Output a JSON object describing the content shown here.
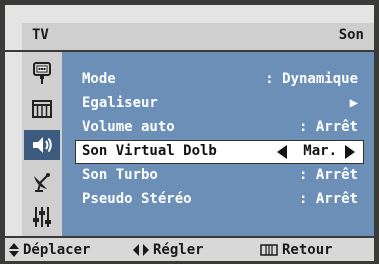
{
  "header": {
    "tv_label": "TV",
    "section_title": "Son"
  },
  "sidebar": {
    "items": [
      {
        "icon": "antenna-input-icon"
      },
      {
        "icon": "picture-grid-icon"
      },
      {
        "icon": "speaker-icon",
        "active": true
      },
      {
        "icon": "satellite-dish-icon"
      },
      {
        "icon": "settings-sliders-icon"
      }
    ]
  },
  "menu": {
    "items": [
      {
        "label": "Mode",
        "value": ": Dynamique"
      },
      {
        "label": "Egaliseur",
        "value": "▶"
      },
      {
        "label": "Volume auto",
        "value": ": Arrêt"
      },
      {
        "label": "Son Virtual Dolb",
        "value": "Mar.",
        "selected": true
      },
      {
        "label": "Son Turbo",
        "value": ": Arrêt"
      },
      {
        "label": "Pseudo Stéréo",
        "value": ": Arrêt"
      }
    ]
  },
  "footer": {
    "move_label": "Déplacer",
    "adjust_label": "Régler",
    "back_label": "Retour"
  },
  "colors": {
    "content_bg": "#6b8fb7",
    "active_icon_bg": "#3d5a7f",
    "selected_row_bg": "#ffffff"
  }
}
